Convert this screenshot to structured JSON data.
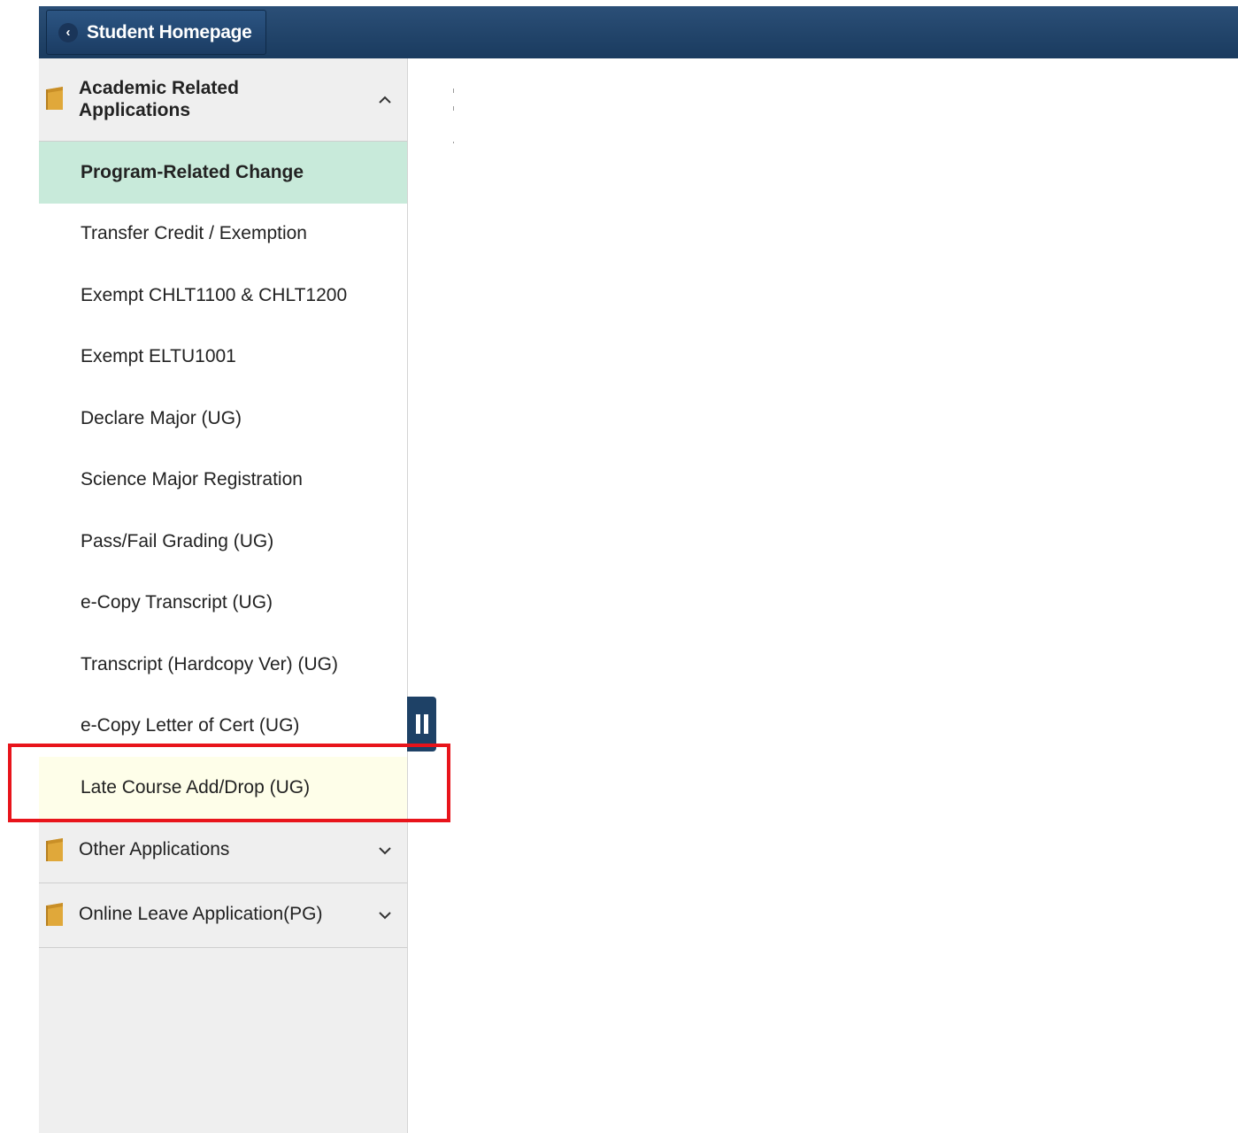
{
  "header": {
    "home_label": "Student Homepage"
  },
  "sidebar": {
    "groups": [
      {
        "title": "Academic Related Applications",
        "expanded": true,
        "items": [
          {
            "label": "Program-Related Change",
            "state": "selected"
          },
          {
            "label": "Transfer Credit / Exemption"
          },
          {
            "label": "Exempt CHLT1100 & CHLT1200"
          },
          {
            "label": "Exempt ELTU1001"
          },
          {
            "label": "Declare Major (UG)"
          },
          {
            "label": "Science Major Registration"
          },
          {
            "label": "Pass/Fail Grading (UG)"
          },
          {
            "label": "e-Copy Transcript (UG)"
          },
          {
            "label": "Transcript (Hardcopy Ver) (UG)"
          },
          {
            "label": "e-Copy Letter of Cert (UG)"
          },
          {
            "label": "Late Course Add/Drop (UG)",
            "state": "hover"
          }
        ]
      },
      {
        "title": "Other Applications",
        "expanded": false
      },
      {
        "title": "Online Leave Application(PG)",
        "expanded": false
      }
    ]
  },
  "icons": {
    "back": "chevron-left-icon",
    "folder": "folder-icon",
    "collapse": "collapse-icon",
    "expand": "expand-icon",
    "pause_handle": "pause-icon"
  },
  "colors": {
    "header_bg": "#1a3b5f",
    "selected_bg": "#c8eada",
    "hover_bg": "#fefee9",
    "folder": "#e0a83a",
    "annotation": "#e8141b"
  }
}
